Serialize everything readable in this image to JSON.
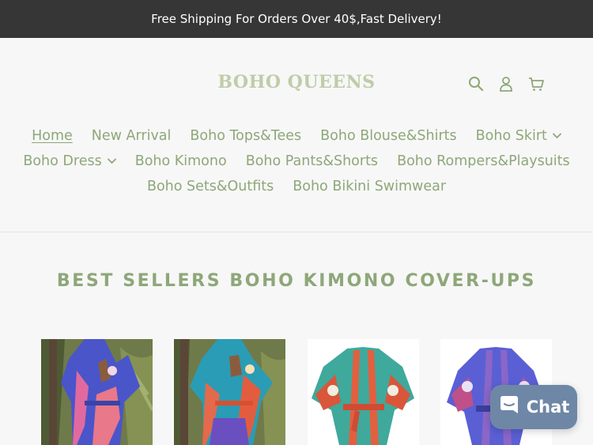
{
  "announcement": {
    "text": "Free Shipping For Orders Over 40$,Fast Delivery!"
  },
  "header": {
    "logo": "BOHO QUEENS",
    "icons": [
      "search-icon",
      "account-icon",
      "cart-icon"
    ]
  },
  "nav": {
    "rows": [
      [
        {
          "label": "Home",
          "active": true
        },
        {
          "label": "New Arrival"
        },
        {
          "label": "Boho Tops&Tees"
        },
        {
          "label": "Boho Blouse&Shirts"
        },
        {
          "label": "Boho Skirt",
          "dropdown": true
        }
      ],
      [
        {
          "label": "Boho Dress",
          "dropdown": true
        },
        {
          "label": "Boho Kimono"
        },
        {
          "label": "Boho Pants&Shorts"
        },
        {
          "label": "Boho Rompers&Playsuits"
        }
      ],
      [
        {
          "label": "Boho Sets&Outfits"
        },
        {
          "label": "Boho Bikini Swimwear"
        }
      ]
    ]
  },
  "section": {
    "title": "BEST SELLERS BOHO KIMONO COVER-UPS"
  },
  "products": [
    {
      "image": "model in blue and pink crane print kimono",
      "background": "jungle"
    },
    {
      "image": "model in teal and coral phoenix print kimono",
      "background": "jungle"
    },
    {
      "image": "teal and coral kimono on white",
      "background": "white"
    },
    {
      "image": "blue and purple moon print kimono on white",
      "background": "white"
    }
  ],
  "chat": {
    "label": "Chat"
  },
  "colors": {
    "accent": "#8ea779",
    "logo": "#bfcca8",
    "announcement_bg": "#363636",
    "chat_bg": "#6e87a6"
  }
}
